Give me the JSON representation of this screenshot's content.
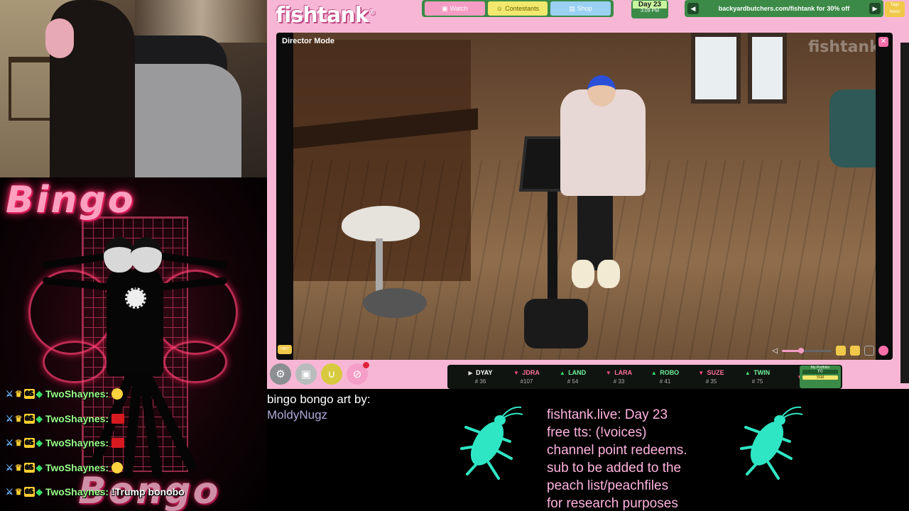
{
  "bingo_art": {
    "top_text": "Bingo",
    "bottom_text": "Bongo"
  },
  "chat": {
    "lines": [
      {
        "user": "TwoShaynes:",
        "message": "",
        "emote": "laugh"
      },
      {
        "user": "TwoShaynes:",
        "message": "",
        "emote": "red"
      },
      {
        "user": "TwoShaynes:",
        "message": "",
        "emote": "red"
      },
      {
        "user": "TwoShaynes:",
        "message": "",
        "emote": "laugh"
      },
      {
        "user": "TwoShaynes:",
        "message": "!Trump bonobo",
        "emote": ""
      }
    ],
    "badge_number": "65"
  },
  "site": {
    "logo": "fishtank",
    "nav": {
      "watch": "Watch",
      "contestants": "Contestants",
      "shop": "Shop"
    },
    "day": "Day 23",
    "time": "3:09 PM",
    "promo": "backyardbutchers.com/fishtank for 30% off",
    "mini_tag": "Tags News",
    "hint_label": "HINT"
  },
  "player": {
    "mode_label": "Director Mode",
    "watermark": "fishtank",
    "volume_fraction": 0.38
  },
  "ticker": [
    {
      "name": "DYAY",
      "rank": "# 36",
      "dir": "flat"
    },
    {
      "name": "JDRA",
      "rank": "#107",
      "dir": "down"
    },
    {
      "name": "LAND",
      "rank": "# 54",
      "dir": "up"
    },
    {
      "name": "LARA",
      "rank": "# 33",
      "dir": "down"
    },
    {
      "name": "ROBO",
      "rank": "# 41",
      "dir": "up"
    },
    {
      "name": "SUZE",
      "rank": "# 35",
      "dir": "down"
    },
    {
      "name": "TWIN",
      "rank": "# 75",
      "dir": "up"
    },
    {
      "name": "B",
      "rank": "",
      "dir": "down"
    }
  ],
  "portfolio": {
    "label": "My Portfolio",
    "value": "F0",
    "stat": "Stat"
  },
  "credit": {
    "line1": "bingo bongo art by:",
    "artist": "MoldyNugz"
  },
  "info": {
    "lines": [
      "fishtank.live: Day 23",
      "free tts: (!voices)",
      "channel point redeems.",
      "sub to be added to the",
      "peach list/peachfiles",
      "for research purposes"
    ]
  },
  "colors": {
    "frame_pink": "#f7b7d4",
    "accent_green": "#3b8a47",
    "chat_green": "#7dff7a",
    "info_pink": "#ffb3df",
    "roach_cyan": "#2fe6c4"
  }
}
